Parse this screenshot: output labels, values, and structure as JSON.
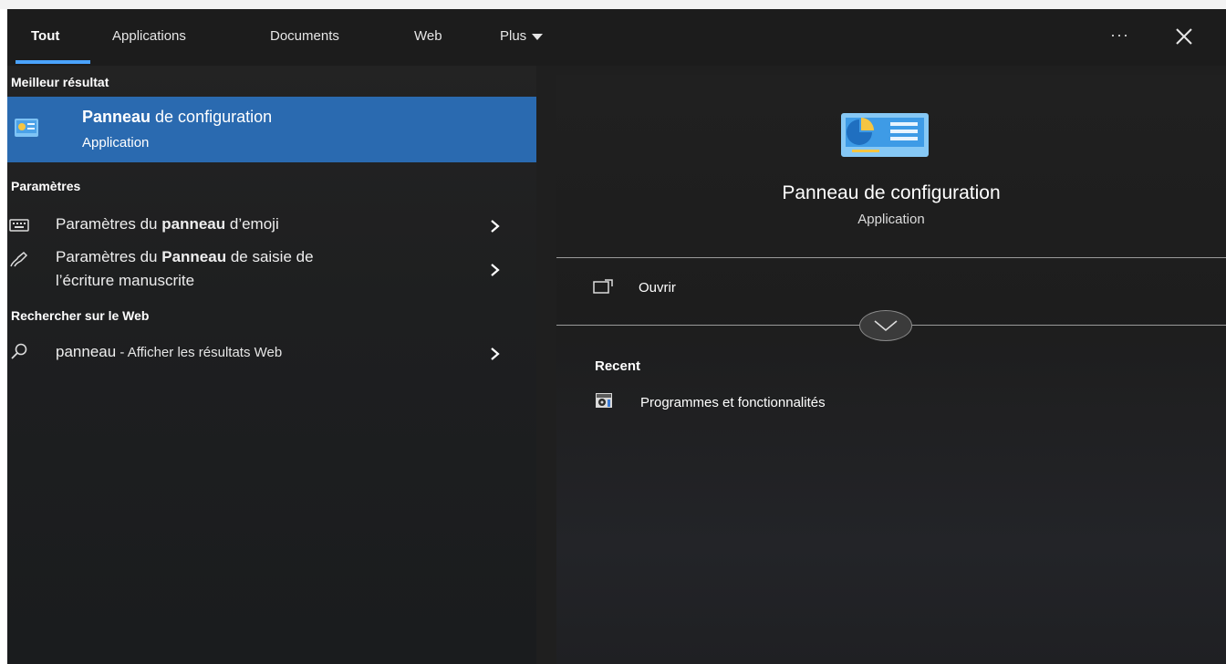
{
  "tabs": {
    "all": "Tout",
    "apps": "Applications",
    "documents": "Documents",
    "web": "Web",
    "more": "Plus"
  },
  "toolbar": {
    "more_options": "...",
    "close": "close-icon"
  },
  "left": {
    "best_match_header": "Meilleur résultat",
    "best_match": {
      "title_bold": "Panneau",
      "title_rest": " de configuration",
      "subtitle": "Application",
      "icon": "control-panel-icon"
    },
    "settings_header": "Paramètres",
    "settings": [
      {
        "prefix": "Paramètres du ",
        "bold": "panneau",
        "suffix": " d’emoji",
        "icon": "keyboard-icon"
      },
      {
        "prefix": "Paramètres du ",
        "bold": "Panneau",
        "suffix": " de saisie de",
        "line2": "l’écriture manuscrite",
        "icon": "pen-icon"
      }
    ],
    "web_header": "Rechercher sur le Web",
    "web": {
      "query": "panneau",
      "suffix": " - Afficher les résultats Web",
      "icon": "search-icon"
    }
  },
  "right": {
    "title": "Panneau de configuration",
    "subtitle": "Application",
    "open_label": "Ouvrir",
    "recent_header": "Recent",
    "recent": [
      {
        "label": "Programmes et fonctionnalités",
        "icon": "programs-features-icon"
      }
    ]
  },
  "colors": {
    "accent": "#4aa3ff",
    "selected_bg": "#2a6ab0",
    "panel_bg": "#1f1f1f"
  }
}
